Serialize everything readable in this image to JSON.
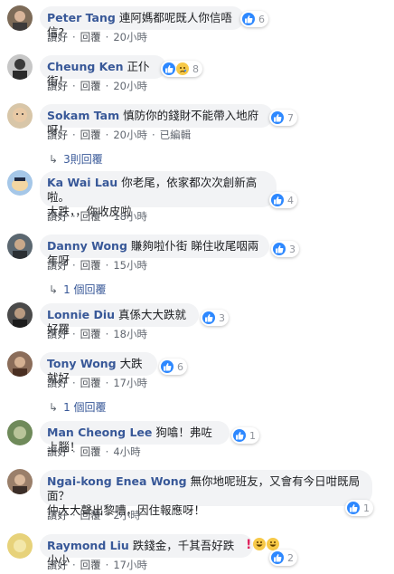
{
  "labels": {
    "like": "讚好",
    "reply": "回覆",
    "edited": "已編輯"
  },
  "comments": [
    {
      "name": "Peter Tang",
      "text": "連阿媽都呢既人你信唔信?",
      "count": "6",
      "time": "20小時"
    },
    {
      "name": "Cheung Ken",
      "text": "正仆街！",
      "count": "8",
      "time": "20小時"
    },
    {
      "name": "Sokam Tam",
      "text": "慎防你的錢財不能帶入地府呀！",
      "count": "7",
      "time": "20小時",
      "replies": "3則回覆"
    },
    {
      "name": "Ka Wai Lau",
      "text": "你老尾，依家都次次創新高啦。",
      "text2": "大跌，，你收皮啦",
      "count": "4",
      "time": "18小時"
    },
    {
      "name": "Danny Wong",
      "text": "賺夠啦仆街 睇住收尾咽兩年呀",
      "count": "3",
      "time": "15小時",
      "replies": "1 個回覆"
    },
    {
      "name": "Lonnie Diu",
      "text": "真係大大跌就好羅",
      "count": "3",
      "time": "18小時"
    },
    {
      "name": "Tony Wong",
      "text": "大跌就好",
      "count": "6",
      "time": "17小時",
      "replies": "1 個回覆"
    },
    {
      "name": "Man Cheong Lee",
      "text": "狗噏！弗咗上腦！",
      "count": "1",
      "time": "4小時"
    },
    {
      "name": "Ngai-kong Enea Wong",
      "text": "無你地呢班友，又會有今日咁既局面？",
      "text2": "仲大大聲出黎嘈，因住報應呀！",
      "count": "1",
      "time": "2小時"
    },
    {
      "name": "Raymond Liu",
      "text": "跌錢金，千其吾好跌小小",
      "count": "2",
      "time": "17小時"
    }
  ],
  "colors": {
    "name": "#385898",
    "bubble": "#f2f3f5",
    "like": "#2d88ff",
    "meta": "#616770"
  }
}
